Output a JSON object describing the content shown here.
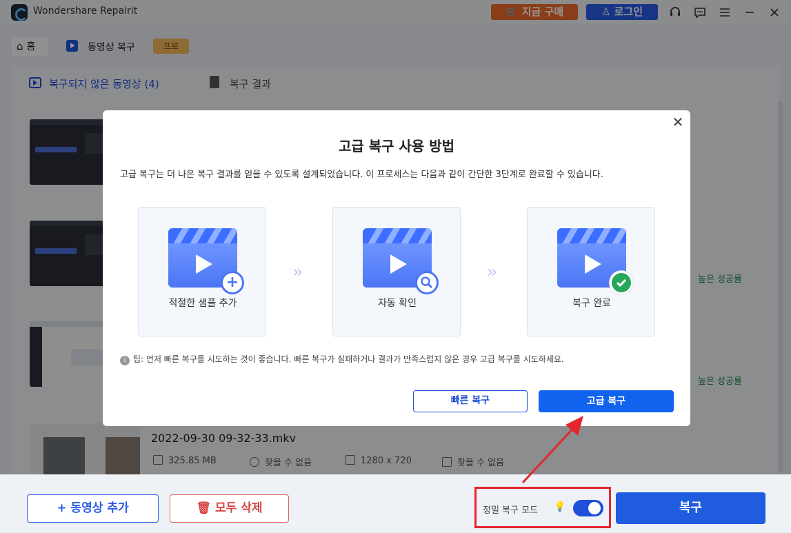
{
  "titlebar": {
    "app_title": "Wondershare Repairit",
    "buy_label": "🛒 지금 구매",
    "login_label": "♙ 로그인",
    "icons": [
      "headset-icon",
      "chat-icon",
      "menu-icon",
      "minimize-icon",
      "close-icon"
    ]
  },
  "breadcrumb": {
    "home": "홈",
    "current": "동영상 복구",
    "badge": "프로"
  },
  "tabs": [
    {
      "label": "복구되지 않은 동영상 (4)"
    },
    {
      "label": "복구 결과"
    }
  ],
  "files": [
    {
      "status": ""
    },
    {
      "status": "높은 성공률"
    },
    {
      "status": "높은 성공률"
    },
    {
      "name": "2022-09-30 09-32-33.mkv",
      "size": "325.85 MB",
      "duration": "찾을 수 없음",
      "resolution": "1280 x 720",
      "codec": "찾을 수 없음"
    }
  ],
  "bottom": {
    "add_label": "+ 동영상 추가",
    "delete_label": "모두 삭제",
    "mode_label": "정밀 복구 모드",
    "mode_on": true,
    "repair_label": "복구"
  },
  "modal": {
    "title": "고급 복구 사용 방법",
    "description": "고급 복구는 더 나은 복구 결과를 얻을 수 있도록 설계되었습니다. 이 프로세스는 다음과 같이 간단한 3단계로 완료할 수 있습니다.",
    "steps": [
      {
        "label": "적절한 샘플 추가",
        "badge": "+"
      },
      {
        "label": "자동 확인",
        "badge": "search"
      },
      {
        "label": "복구 완료",
        "badge": "check"
      }
    ],
    "tip": "팁: 먼저 빠른 복구를 시도하는 것이 좋습니다. 빠른 복구가 실패하거나 결과가 만족스럽지 않은 경우 고급 복구를 시도하세요.",
    "quick_label": "빠른 복구",
    "advanced_label": "고급 복구"
  },
  "colors": {
    "accent": "#1063ee",
    "highlight": "#e4262f",
    "success": "#1e8a4a"
  }
}
